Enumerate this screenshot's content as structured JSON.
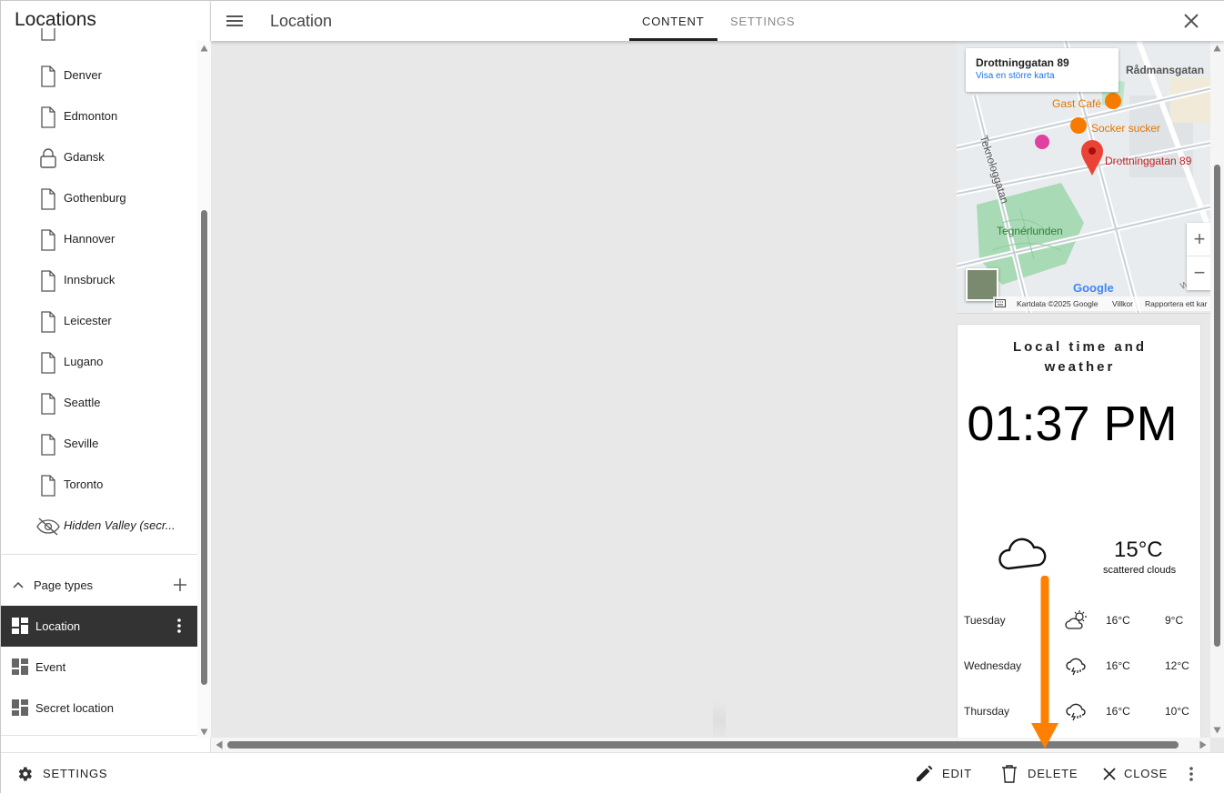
{
  "sidebar": {
    "title": "Locations",
    "locations": [
      {
        "label": "Denver",
        "icon": "page-icon"
      },
      {
        "label": "Edmonton",
        "icon": "page-icon"
      },
      {
        "label": "Gdansk",
        "icon": "lock-icon"
      },
      {
        "label": "Gothenburg",
        "icon": "page-icon"
      },
      {
        "label": "Hannover",
        "icon": "page-icon"
      },
      {
        "label": "Innsbruck",
        "icon": "page-icon"
      },
      {
        "label": "Leicester",
        "icon": "page-icon"
      },
      {
        "label": "Lugano",
        "icon": "page-icon"
      },
      {
        "label": "Seattle",
        "icon": "page-icon"
      },
      {
        "label": "Seville",
        "icon": "page-icon"
      },
      {
        "label": "Toronto",
        "icon": "page-icon"
      },
      {
        "label": "Hidden Valley (secr...",
        "icon": "hidden-eye-icon"
      }
    ],
    "page_types_label": "Page types",
    "page_types": [
      {
        "label": "Location",
        "active": true
      },
      {
        "label": "Event",
        "active": false
      },
      {
        "label": "Secret location",
        "active": false
      }
    ]
  },
  "topbar": {
    "title": "Location",
    "tabs": [
      {
        "label": "CONTENT",
        "active": true
      },
      {
        "label": "SETTINGS",
        "active": false
      }
    ]
  },
  "map": {
    "address": "Drottninggatan 89",
    "larger_map_link": "Visa en större karta",
    "pin_label": "Drottninggatan 89",
    "places": {
      "gast_cafe": "Gast Café",
      "socker_sucker": "Socker sucker",
      "radmansgatan": "Rådmansgatan",
      "teknologgatan": "Teknologgatan",
      "tegnerlunden": "Tegnérlunden",
      "wall": "Wall"
    },
    "attribution": "Kartdata ©2025 Google",
    "terms": "Villkor",
    "report": "Rapportera ett kar",
    "google": "Google"
  },
  "weather": {
    "heading": "Local time and weather",
    "time": "01:37 PM",
    "temperature": "15°C",
    "description": "scattered clouds",
    "forecast": [
      {
        "day": "Tuesday",
        "icon": "partly-sunny-icon",
        "high": "16°C",
        "low": "9°C"
      },
      {
        "day": "Wednesday",
        "icon": "rain-cloud-icon",
        "high": "16°C",
        "low": "12°C"
      },
      {
        "day": "Thursday",
        "icon": "rain-cloud-icon",
        "high": "16°C",
        "low": "10°C"
      }
    ]
  },
  "bottombar": {
    "settings_label": "SETTINGS",
    "edit_label": "EDIT",
    "delete_label": "DELETE",
    "close_label": "CLOSE"
  },
  "colors": {
    "accent_dark": "#333333",
    "annotation_arrow": "#ff7f00",
    "map_pin": "#ea4335",
    "map_poi": "#f57c00",
    "park": "#a8dab5"
  }
}
